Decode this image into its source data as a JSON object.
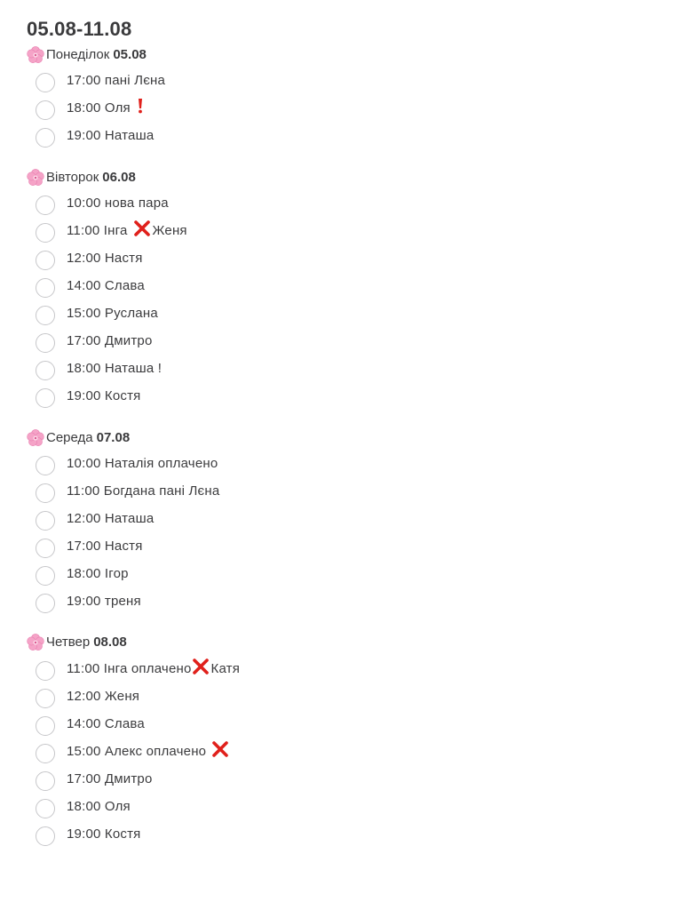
{
  "note": {
    "title": "05.08-11.08"
  },
  "days": [
    {
      "name": "Понеділок",
      "date": "05.08",
      "tasks": [
        {
          "text": "17:00 пані Лєна"
        },
        {
          "text": "18:00 Оля",
          "mark": "red-exclamation-icon"
        },
        {
          "text": "19:00 Наташа"
        }
      ]
    },
    {
      "name": "Вівторок",
      "date": "06.08",
      "tasks": [
        {
          "text": "10:00 нова пара"
        },
        {
          "text": "11:00 Інга",
          "mark": "red-cross-icon",
          "after": "Женя"
        },
        {
          "text": "12:00 Настя"
        },
        {
          "text": "14:00 Слава"
        },
        {
          "text": "15:00 Руслана"
        },
        {
          "text": "17:00 Дмитро"
        },
        {
          "text": "18:00 Наташа !"
        },
        {
          "text": "19:00 Костя"
        }
      ]
    },
    {
      "name": "Середа",
      "date": "07.08",
      "tasks": [
        {
          "text": "10:00 Наталія оплачено"
        },
        {
          "text": "11:00 Богдана пані Лєна"
        },
        {
          "text": "12:00 Наташа"
        },
        {
          "text": "17:00 Настя"
        },
        {
          "text": "18:00 Ігор"
        },
        {
          "text": "19:00 треня"
        }
      ]
    },
    {
      "name": "Четвер",
      "date": "08.08",
      "tasks": [
        {
          "text": "11:00 Інга оплачено",
          "mark": "red-cross-icon",
          "after": "Катя"
        },
        {
          "text": "12:00 Женя"
        },
        {
          "text": "14:00 Слава"
        },
        {
          "text": "15:00 Алекс оплачено",
          "mark": "red-cross-icon"
        },
        {
          "text": "17:00 Дмитро"
        },
        {
          "text": "18:00 Оля"
        },
        {
          "text": "19:00 Костя"
        }
      ]
    }
  ],
  "colors": {
    "text": "#3c3c3e",
    "checkbox_border": "#c6c6c9",
    "cross": "#e0201b",
    "exclamation": "#e0201b",
    "flower": "#f5a3c7"
  }
}
